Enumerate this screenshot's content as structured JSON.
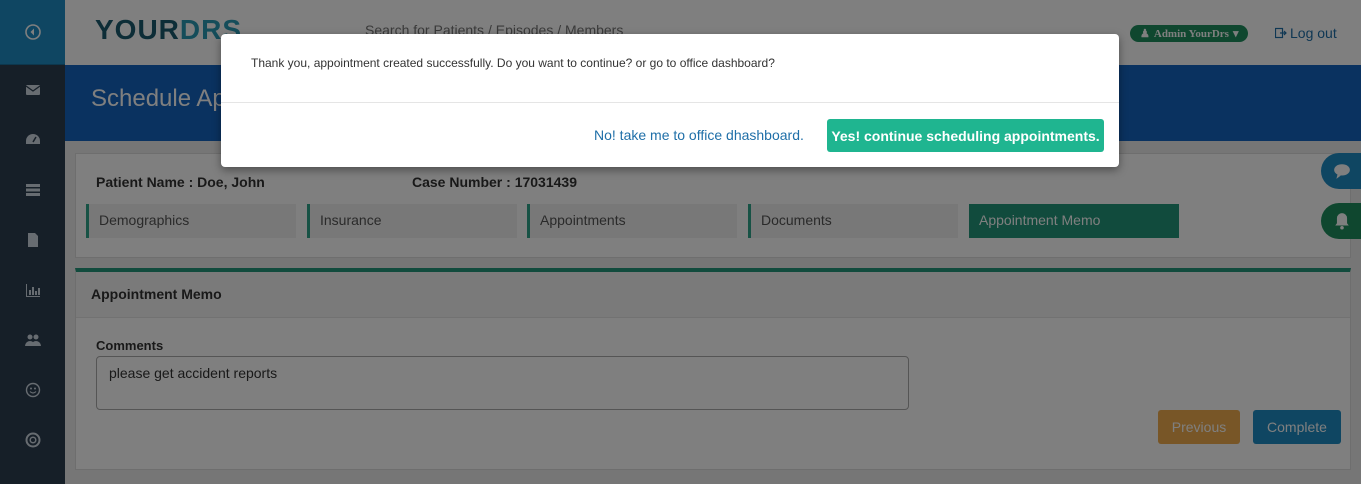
{
  "app": {
    "logo_prefix": "YOUR",
    "logo_suffix": "DRS",
    "search_placeholder": "Search for Patients / Episodes / Members",
    "admin_label": "Admin YourDrs",
    "logout_label": "Log out"
  },
  "sidebar": {
    "items": [
      {
        "icon": "arrow-circle-left-icon"
      },
      {
        "icon": "envelope-icon"
      },
      {
        "icon": "dashboard-icon"
      },
      {
        "icon": "list-icon"
      },
      {
        "icon": "document-icon"
      },
      {
        "icon": "bar-chart-icon"
      },
      {
        "icon": "users-icon"
      },
      {
        "icon": "smiley-icon"
      },
      {
        "icon": "life-ring-icon"
      }
    ]
  },
  "page": {
    "title": "Schedule Ap"
  },
  "patient": {
    "name_label": "Patient Name : Doe, John",
    "case_label": "Case Number : 17031439"
  },
  "tabs": [
    {
      "label": "Demographics",
      "active": false
    },
    {
      "label": "Insurance",
      "active": false
    },
    {
      "label": "Appointments",
      "active": false
    },
    {
      "label": "Documents",
      "active": false
    },
    {
      "label": "Appointment Memo",
      "active": true
    }
  ],
  "memo": {
    "heading": "Appointment Memo",
    "comments_label": "Comments",
    "comments_value": "please get accident reports",
    "previous_label": "Previous",
    "complete_label": "Complete"
  },
  "modal": {
    "message": "Thank you, appointment created successfully. Do you want to continue? or go to office dashboard?",
    "no_label": "No! take me to office dhashboard.",
    "yes_label": "Yes! continue scheduling appointments."
  },
  "colors": {
    "sidebar": "#2c3e50",
    "accent_blue": "#1565c0",
    "accent_green": "#23967a",
    "modal_button": "#1fb590",
    "previous_button": "#f0ad4e"
  }
}
